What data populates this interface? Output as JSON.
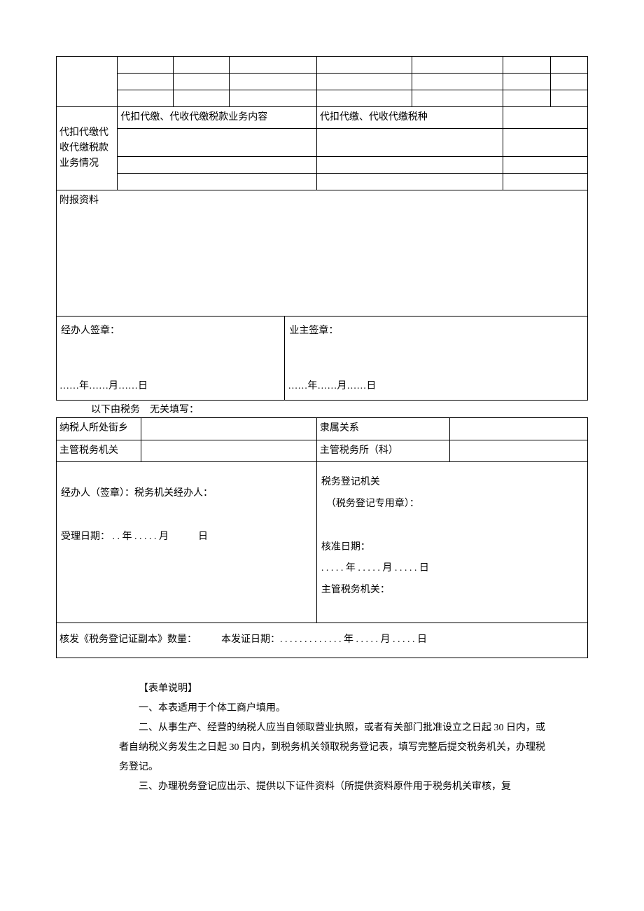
{
  "table1": {
    "withholding_row_label": "代扣代缴代收代缴税款业务情况",
    "withholding_content_label": "代扣代缴、代收代缴税款业务内容",
    "withholding_type_label": "代扣代缴、代收代缴税种",
    "attachment_label": "附报资料",
    "handler_sign_label": "经办人签章：",
    "owner_sign_label": "业主签章：",
    "date1": "……年……月……日",
    "date2": "……年……月……日"
  },
  "interline": "以下由税务　无关填写：",
  "table2": {
    "street_label": "纳税人所处街乡",
    "affiliation_label": "隶属关系",
    "authority_label": "主管税务机关",
    "office_label": "主管税务所（科）",
    "handler_sign": "经办人（签章）：税务机关经办人：",
    "accept_date": "受理日期： . . 年 . . . . . 月　　　日",
    "reg_authority_line1": "税务登记机关",
    "reg_authority_line2": "　（税务登记专用章）：",
    "approve_date_label": "核准日期：",
    "approve_date_value": ". . . . . 年 . . . . . 月 . . . . . 日",
    "supervising_authority": "主管税务机关：",
    "issue_line": "核发《税务登记证副本》数量：　　　本发证日期：. . . . . . . . . . . . . 年 . . . . . 月 . . . . . 日"
  },
  "instructions": {
    "title": "【表单说明】",
    "p1": "一、本表适用于个体工商户填用。",
    "p2": "二、从事生产、经营的纳税人应当自领取营业执照，或者有关部门批准设立之日起 30 日内，或者自纳税义务发生之日起 30 日内，到税务机关领取税务登记表，填写完整后提交税务机关，办理税务登记。",
    "p3": "三、办理税务登记应出示、提供以下证件资料（所提供资料原件用于税务机关审核，复"
  }
}
